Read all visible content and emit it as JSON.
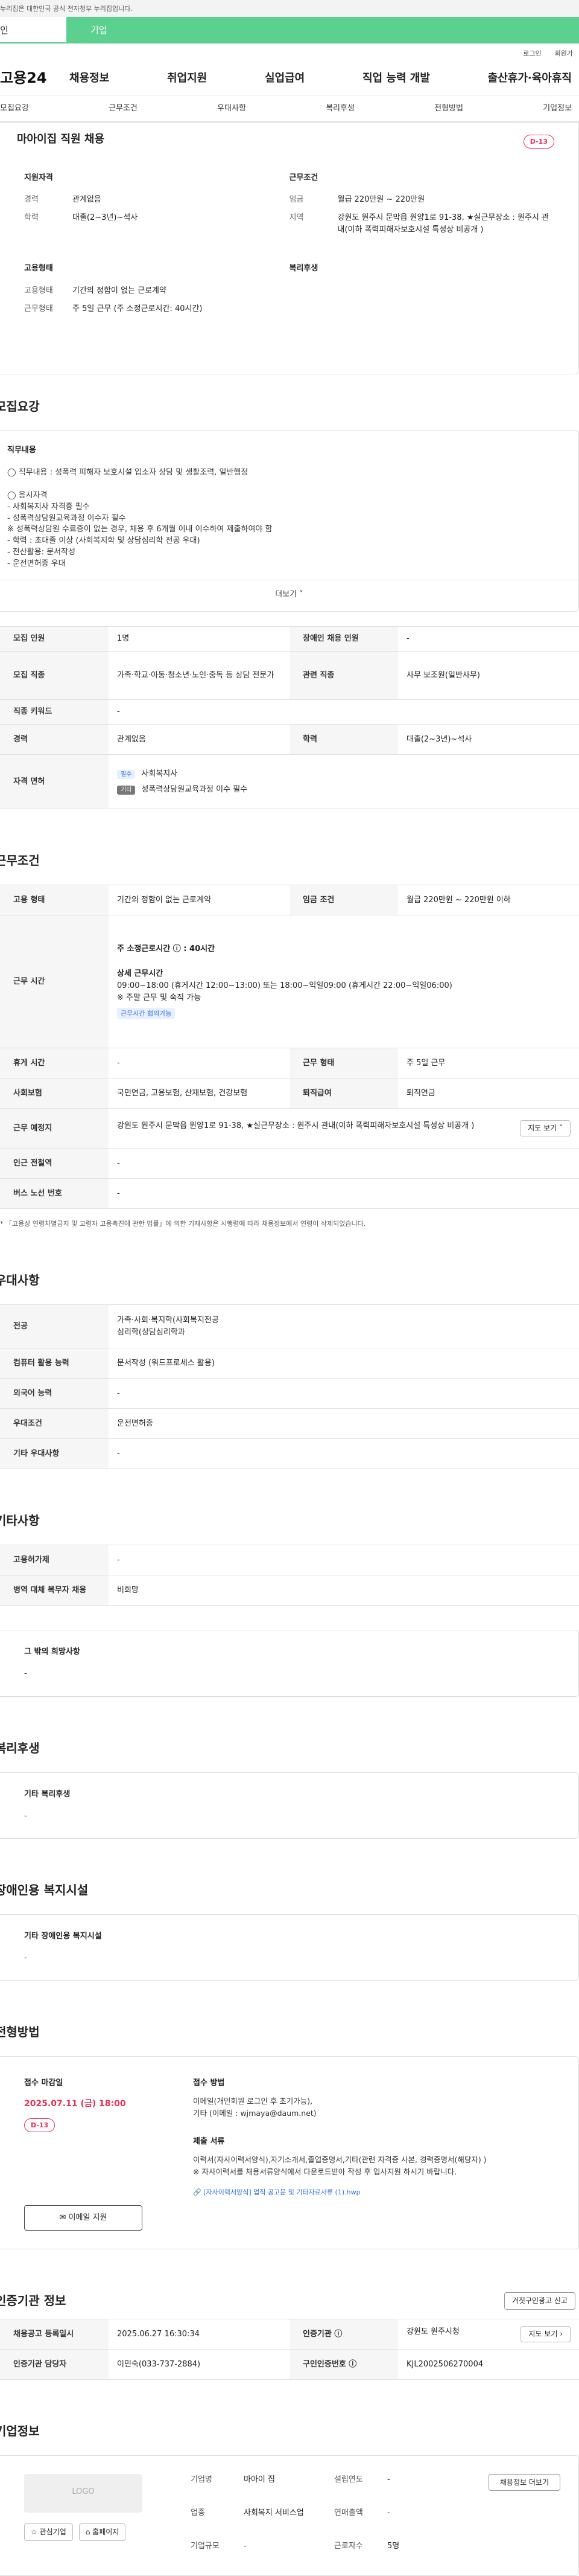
{
  "notice": "누리집은 대한민국 공식 전자정부 누리집입니다.",
  "tabs": {
    "personal": "인",
    "corporate": "기업"
  },
  "toplinks": [
    "로그인",
    "회원가"
  ],
  "logo": "고용24",
  "gnb": [
    "채용정보",
    "취업지원",
    "실업급여",
    "직업 능력 개발",
    "출산휴가·육아휴직"
  ],
  "subnav": [
    "모집요강",
    "근무조건",
    "우대사항",
    "복리후생",
    "전형방법",
    "기업정보"
  ],
  "summary": {
    "title": "마아이집 직원 채용",
    "dday": "D-13",
    "qual_title": "지원자격",
    "career_k": "경력",
    "career_v": "관계없음",
    "edu_k": "학력",
    "edu_v": "대졸(2~3년)~석사",
    "work_title": "근무조건",
    "wage_k": "임금",
    "wage_v": "월급 220만원 ~ 220만원",
    "area_k": "지역",
    "area_v": "강원도 원주시 문막읍 원양1로 91-38, ★실근무장소 : 원주시 관내(이하 폭력피해자보호시설 특성상 비공개 )",
    "emp_title": "고용형태",
    "type_k": "고용형태",
    "type_v": "기간의 정함이 없는 근로계약",
    "form_k": "근무형태",
    "form_v": "주 5일 근무 (주 소정근로시간: 40시간)",
    "welfare_title": "복리후생"
  },
  "recruit": {
    "title": "모집요강",
    "job_title": "직무내용",
    "lines": [
      "◯ 직무내용 : 성폭력 피해자 보호시설 입소자 상담 및 생활조력, 일반행정",
      "",
      "◯ 응시자격",
      "- 사회복지사 자격증 필수",
      "- 성폭력상담원교육과정 이수자 필수",
      "※ 성폭력상담원 수료증이 없는 경우, 채용 후 6개월 이내 이수하여 제출하여야 함",
      "- 학력 : 초대졸 이상 (사회복지학 및 상담심리학 전공 우대)",
      "- 전산활용: 문서작성",
      "- 운전면허증 우대"
    ],
    "more": "더보기 ˅"
  },
  "recruit_table": {
    "count_k": "모집 인원",
    "count_v": "1명",
    "disabled_k": "장애인 채용 인원",
    "disabled_v": "-",
    "job_k": "모집 직종",
    "job_v": "가족·학교·아동·청소년·노인·중독 등 상담 전문가",
    "related_k": "관련 직종",
    "related_v": "사무 보조원(일반사무)",
    "keyword_k": "직종 키워드",
    "keyword_v": "-",
    "career_k": "경력",
    "career_v": "관계없음",
    "edu_k": "학력",
    "edu_v": "대졸(2~3년)~석사",
    "license_k": "자격 면허",
    "license_chip1": "필수",
    "license_v1": "사회복지사",
    "license_chip2": "기타",
    "license_v2": "성폭력상담원교육과정 이수 필수"
  },
  "work": {
    "title": "근무조건",
    "type_k": "고용 형태",
    "type_v": "기간의 정함이 없는 근로계약",
    "wage_k": "임금 조건",
    "wage_v": "월급 220만원 ~ 220만원 이하",
    "time_k": "근무 시간",
    "time_total": "주 소정근로시간 ⓘ : 40시간",
    "time_detail_title": "상세 근무시간",
    "time_detail": "09:00~18:00 (휴게시간 12:00~13:00) 또는 18:00~익일09:00 (휴게시간 22:00~익일06:00)",
    "time_note": "※ 주말 근무 및 숙직 가능",
    "time_tag": "근무시간 협의가능",
    "rest_k": "휴게 시간",
    "rest_v": "-",
    "form_k": "근무 형태",
    "form_v": "주 5일 근무",
    "insurance_k": "사회보험",
    "insurance_v": "국민연금, 고용보험, 산재보험, 건강보험",
    "retire_k": "퇴직급여",
    "retire_v": "퇴직연금",
    "place_k": "근무 예정지",
    "place_v": "강원도 원주시 문막읍 원양1로 91-38, ★실근무장소 : 원주시 관내(이하 폭력피해자보호시설 특성상 비공개 )",
    "map_btn": "지도 보기 ˅",
    "subway_k": "인근 전철역",
    "subway_v": "-",
    "bus_k": "버스 노선 번호",
    "bus_v": "-",
    "note": "* 「고용상 연령차별금지 및 고령자 고용촉진에 관한 법률」에 의한 기재사항은 시행령에 따라 채용정보에서 연령이 삭제되었습니다."
  },
  "pref": {
    "title": "우대사항",
    "major_k": "전공",
    "major_v1": "가족·사회·복지학(사회복지전공",
    "major_v2": "심리학(상담심리학과",
    "pc_k": "컴퓨터 활용 능력",
    "pc_v": "문서작성 (워드프로세스 활용)",
    "lang_k": "외국어 능력",
    "lang_v": "-",
    "cond_k": "우대조건",
    "cond_v": "운전면허증",
    "etc_k": "기타 우대사항",
    "etc_v": "-"
  },
  "other": {
    "title": "기타사항",
    "emp_k": "고용허가제",
    "emp_v": "-",
    "mil_k": "병역 대체 복무자 채용",
    "mil_v": "비희망",
    "wish_title": "그 밖의 희망사항",
    "wish_v": "-"
  },
  "welfare": {
    "title": "복리후생",
    "box_title": "기타 복리후생",
    "box_v": "-"
  },
  "disabled": {
    "title": "장애인용 복지시설",
    "box_title": "기타 장애인용 복지시설",
    "box_v": "-"
  },
  "process": {
    "title": "전형방법",
    "deadline_title": "접수 마감일",
    "deadline": "2025.07.11 (금) 18:00",
    "dday": "D-13",
    "email_btn": "✉ 이메일 지원",
    "method_title": "접수 방법",
    "method1": "이메일(개인회원 로그인 후 초기가능),",
    "method2": "기타 (이메일 : wjmaya@daum.net)",
    "docs_title": "제출 서류",
    "docs1": "이력서(자사이력서양식),자기소개서,졸업증명서,기타(관련 자격증 사본, 경력증명서(해당자) )",
    "docs2": "※ 자사이력서를 채용서류양식에서 다운로드받아 작성 후 입사지원 하시기 바랍니다.",
    "attach": "[자사이력서양식] 업직 공고문 및 기타자료서류 (1).hwp"
  },
  "agency": {
    "title": "인증기관 정보",
    "report_btn": "거짓구인광고 신고",
    "reg_k": "채용공고 등록일시",
    "reg_v": "2025.06.27 16:30:34",
    "org_k": "인증기관 ⓘ",
    "org_v": "강원도 원주시청",
    "map_btn": "지도 보기 ›",
    "mgr_k": "인증기관 담당자",
    "mgr_v": "이민숙(033-737-2884)",
    "no_k": "구인인증번호 ⓘ",
    "no_v": "KJL2002506270004"
  },
  "company": {
    "title": "기업정보",
    "logo": "LOGO",
    "fav_btn": "☆ 관심기업",
    "home_btn": "⌂ 홈페이지",
    "name_k": "기업명",
    "name_v": "마아이 집",
    "year_k": "설립연도",
    "year_v": "-",
    "ind_k": "업종",
    "ind_v": "사회복지 서비스업",
    "sales_k": "연매출액",
    "sales_v": "-",
    "size_k": "기업규모",
    "size_v": "-",
    "emp_k": "근로자수",
    "emp_v": "5명",
    "hire_btn": "채용정보 더보기"
  }
}
